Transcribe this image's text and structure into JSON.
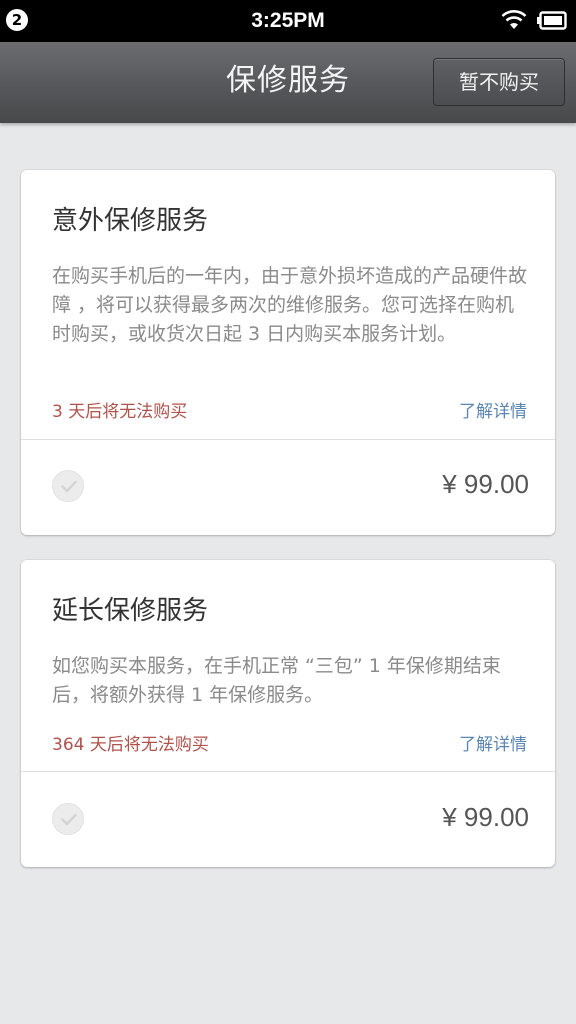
{
  "status_bar": {
    "notification_count": "2",
    "time": "3:25PM",
    "icons": [
      "wifi-icon",
      "battery-icon"
    ]
  },
  "header": {
    "title": "保修服务",
    "skip_label": "暂不购买"
  },
  "plans": [
    {
      "title": "意外保修服务",
      "description": "在购买手机后的一年内，由于意外损坏造成的产品硬件故障 ，将可以获得最多两次的维修服务。您可选择在购机时购买，或收货次日起 3 日内购买本服务计划。",
      "deadline": "3 天后将无法购买",
      "details_label": "了解详情",
      "price": "¥ 99.00",
      "selected": false
    },
    {
      "title": "延长保修服务",
      "description": "如您购买本服务，在手机正常 “三包” 1 年保修期结束后，将额外获得 1 年保修服务。",
      "deadline": "364 天后将无法购买",
      "details_label": "了解详情",
      "price": "¥ 99.00",
      "selected": false
    }
  ],
  "colors": {
    "background": "#e7e8ea",
    "deadline_text": "#b0524b",
    "link_text": "#5b86b2",
    "title_bar": "#55575a"
  }
}
